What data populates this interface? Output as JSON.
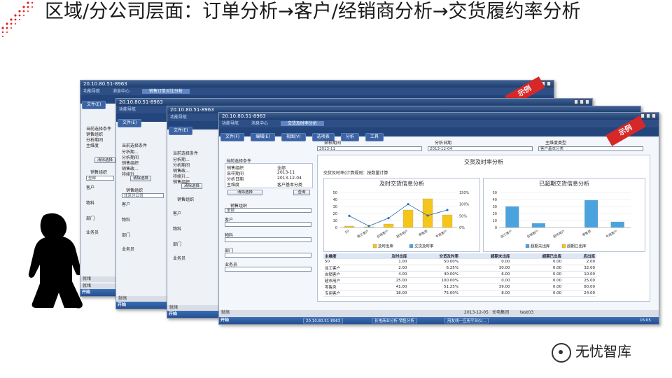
{
  "slide": {
    "title": "区域/分公司层面：订单分析→客户/经销商分析→交货履约率分析",
    "watermark": "无忧智库"
  },
  "colors": {
    "accent": "#1f3e6e",
    "menu": "#2e4f86",
    "badge": "#d62828",
    "bar_yellow": "#f5c518",
    "bar_blue": "#4aa3df"
  },
  "window_common": {
    "title": "20.10.80.51-8963",
    "start_label": "开始",
    "status_label": "就绪",
    "clear_button": "清除选择",
    "query_button": "查询",
    "section_current": "当前选择条件",
    "sales_org": "销售组织",
    "customer": "客户",
    "material": "物料",
    "department": "部门",
    "salesperson": "业务员",
    "analysis_dim": "分析期间",
    "all": "全部"
  },
  "win1": {
    "menu": [
      "功能导航",
      "消息中心",
      "销售订单对比分析"
    ],
    "tool": [
      "文件(E)"
    ],
    "conditions": [
      "销售组织",
      "分析期间",
      "主维度"
    ],
    "status": "就绪"
  },
  "win2": {
    "menu": [
      "功能导航"
    ],
    "tool": [
      "文件(E)"
    ],
    "conditions": [
      "分析期...",
      "分析期间",
      "销售组织",
      "销售政...",
      "持续升..."
    ],
    "org_value": "北京分公司"
  },
  "win3": {
    "menu": [
      "功能导航"
    ],
    "tool": [
      "文件(E)"
    ],
    "conditions": [
      "分析期...",
      "分析期间",
      "销售政...",
      "持续升...",
      "销售组织"
    ]
  },
  "badge_text": "示例",
  "main": {
    "menu": [
      "功能导航",
      "消息中心",
      "交货及时率分析"
    ],
    "tool": [
      "文件(F)",
      "编辑(E)",
      "视图(V)",
      "选项表",
      "分析",
      "工具"
    ],
    "filter_labels": [
      "采样期间",
      "分析日期",
      "主维度类型"
    ],
    "filter_values": [
      "2013-11",
      "2013-12-04",
      "客户基本分类"
    ],
    "cond_rows": [
      {
        "k": "销售组织",
        "v": "全部"
      },
      {
        "k": "采样期间",
        "v": "2013-11"
      },
      {
        "k": "分析日期",
        "v": "2013-12-04"
      },
      {
        "k": "主维度",
        "v": "客户基本分类"
      }
    ],
    "panel_title": "交货及时率分析",
    "sub_title": "交货及时率(计算规则：按数量计算",
    "time_ts": "2013-12-05",
    "company": "长电集团",
    "user": "test03",
    "task_items": [
      "20.10.80.51-8963",
      "长电商业分析-销售分析",
      "用友线一应用平台(U..."
    ],
    "clock": "16:05"
  },
  "chart_data": [
    {
      "type": "bar",
      "title": "及时交货信息分析",
      "categories": [
        "50",
        "融工客户",
        "自销客户",
        "超市用户",
        "零售类",
        "专用客户"
      ],
      "series": [
        {
          "name": "及时出库",
          "values": [
            2,
            1,
            5,
            25,
            41,
            18
          ]
        },
        {
          "name": "交货及时率",
          "values": [
            50,
            6.25,
            40,
            100,
            51.25,
            75
          ]
        }
      ],
      "ylim": [
        0,
        50
      ],
      "y2lim": [
        0,
        150
      ],
      "y_ticks": [
        "0",
        "10",
        "20",
        "30",
        "40",
        "50"
      ],
      "y2_ticks": [
        "0%",
        "50%",
        "100%",
        "150%"
      ],
      "legend": [
        "及时出库",
        "交货及时率"
      ]
    },
    {
      "type": "bar",
      "title": "已超期交货信息分析",
      "categories": [
        "加工客户",
        "自销客户",
        "超市用户",
        "零售类",
        "专用客户"
      ],
      "series": [
        {
          "name": "超期未出库",
          "values": [
            30,
            6,
            0,
            39,
            8
          ]
        },
        {
          "name": "超期已出库",
          "values": [
            0,
            0,
            0,
            0,
            0
          ]
        }
      ],
      "ylim": [
        0,
        50
      ],
      "y_ticks": [
        "0",
        "10",
        "20",
        "30",
        "40",
        "50"
      ],
      "legend": [
        "超期未出库",
        "超期已出库"
      ]
    },
    {
      "type": "table",
      "columns": [
        "主维度",
        "及时出库",
        "交货及时率",
        "超期未出库",
        "超期已出库",
        "应出库"
      ],
      "rows": [
        [
          "50",
          "1.00",
          "50.00%",
          "0.00",
          "0.00",
          "2.00"
        ],
        [
          "加工客户",
          "2.00",
          "6.25%",
          "30.00",
          "0.00",
          "32.00"
        ],
        [
          "自销客户",
          "4.00",
          "40.00%",
          "6.00",
          "0.00",
          "10.00"
        ],
        [
          "超市用户",
          "25.00",
          "100.00%",
          "0.00",
          "0.00",
          "25.00"
        ],
        [
          "零售类",
          "41.00",
          "51.25%",
          "39.00",
          "0.00",
          "80.00"
        ],
        [
          "专用客户",
          "18.00",
          "75.00%",
          "8.00",
          "0.00",
          "24.00"
        ]
      ]
    }
  ]
}
